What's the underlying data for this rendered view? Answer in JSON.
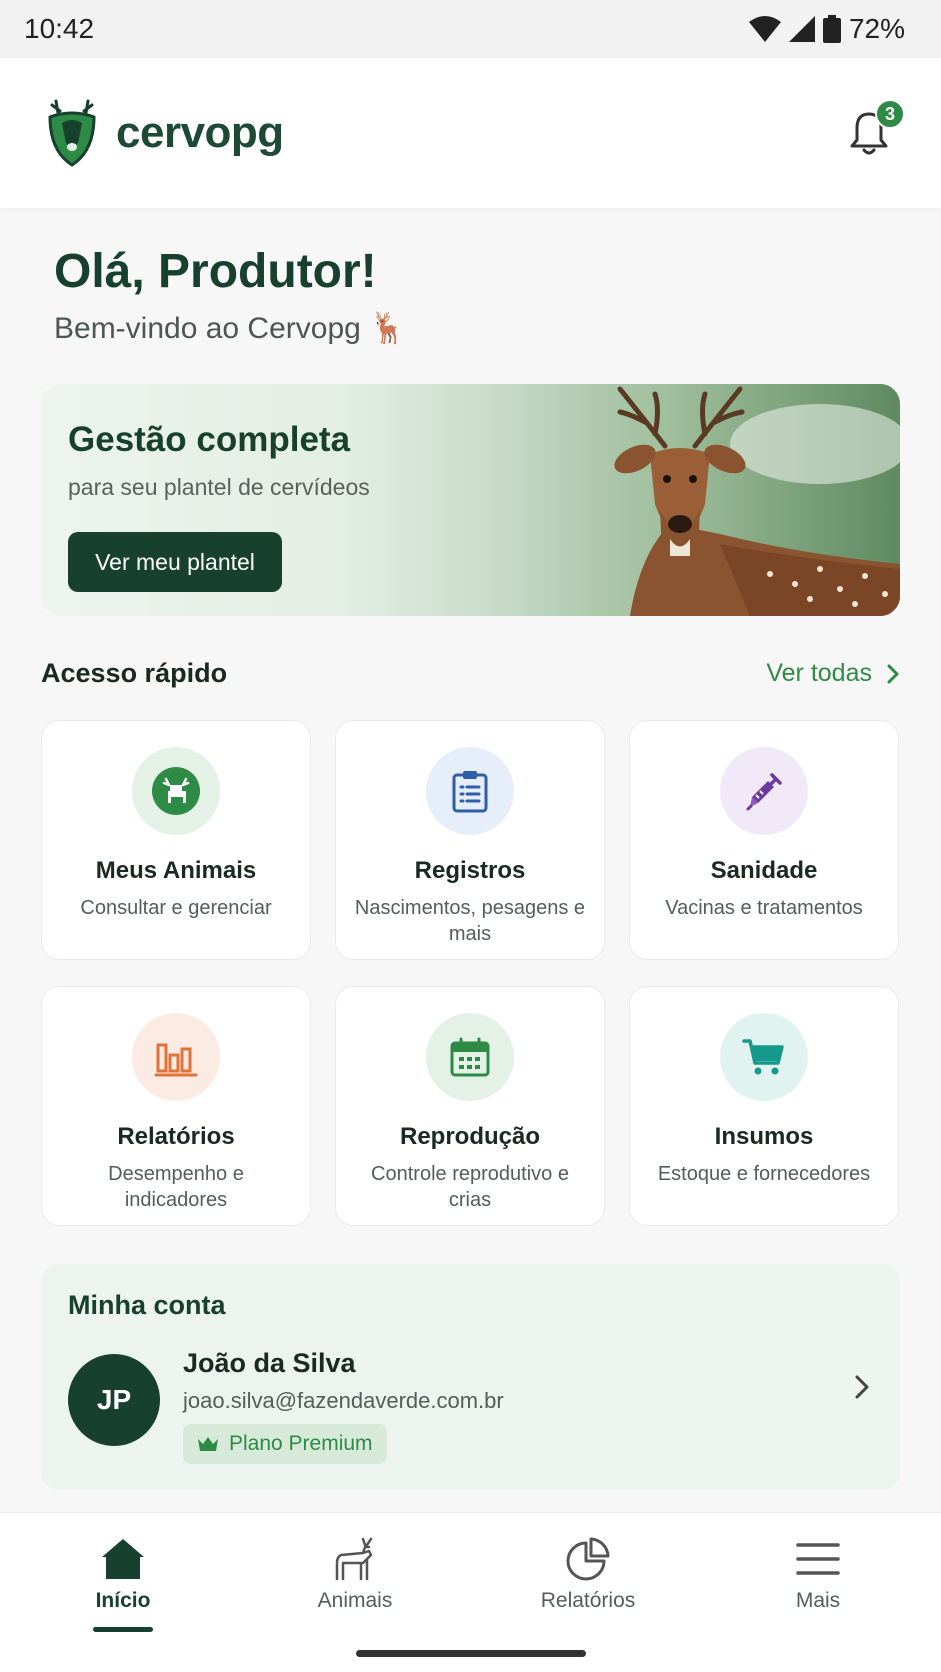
{
  "status_bar": {
    "time": "10:42",
    "battery": "72%",
    "icons": [
      "wifi-icon",
      "signal-icon",
      "battery-icon"
    ]
  },
  "header": {
    "brand": "cervopg",
    "logo": "deer-shield-logo",
    "notification_count": "3",
    "icon": "bell-icon"
  },
  "greeting": {
    "title": "Olá, Produtor!",
    "subtitle": "Bem-vindo ao Cervopg",
    "emoji": "🦌"
  },
  "hero": {
    "title": "Gestão completa",
    "subtitle": "para seu plantel de cervídeos",
    "button": "Ver meu plantel"
  },
  "quick_access": {
    "title": "Acesso rápido",
    "see_all": "Ver todas",
    "cards": [
      {
        "title": "Meus Animais",
        "subtitle": "Consultar e gerenciar",
        "icon": "deer-icon",
        "color": "#2e8b45",
        "bg": "#e4f1e6"
      },
      {
        "title": "Registros",
        "subtitle": "Nascimentos, pesagens e mais",
        "icon": "clipboard-icon",
        "color": "#2f5fa8",
        "bg": "#e6eef9"
      },
      {
        "title": "Sanidade",
        "subtitle": "Vacinas e tratamentos",
        "icon": "syringe-icon",
        "color": "#6a3aa0",
        "bg": "#f1e9f8"
      },
      {
        "title": "Relatórios",
        "subtitle": "Desempenho e indicadores",
        "icon": "bar-chart-icon",
        "color": "#e0733b",
        "bg": "#fcebe3"
      },
      {
        "title": "Reprodução",
        "subtitle": "Controle reprodutivo e crias",
        "icon": "calendar-icon",
        "color": "#2e8b45",
        "bg": "#e4f1e6"
      },
      {
        "title": "Insumos",
        "subtitle": "Estoque e fornecedores",
        "icon": "cart-icon",
        "color": "#159a8c",
        "bg": "#e0f3f1"
      }
    ]
  },
  "account": {
    "title": "Minha conta",
    "initials": "JP",
    "name": "João da Silva",
    "email": "joao.silva@fazendaverde.com.br",
    "plan": "Plano Premium"
  },
  "bottom_nav": [
    {
      "label": "Início",
      "icon": "home-icon",
      "active": true
    },
    {
      "label": "Animais",
      "icon": "deer-outline-icon",
      "active": false
    },
    {
      "label": "Relatórios",
      "icon": "pie-chart-icon",
      "active": false
    },
    {
      "label": "Mais",
      "icon": "menu-icon",
      "active": false
    }
  ],
  "colors": {
    "primary": "#17402e",
    "accent": "#2e8b45"
  }
}
